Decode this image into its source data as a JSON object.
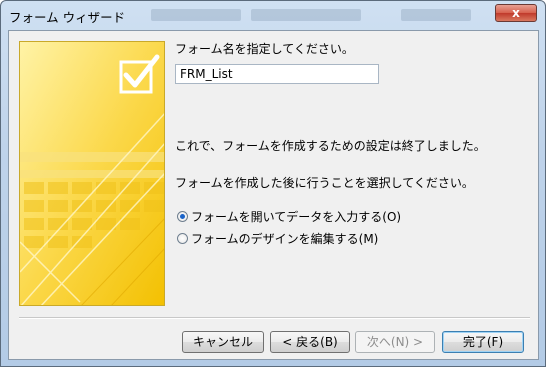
{
  "window": {
    "title": "フォーム ウィザード",
    "close_label": "x"
  },
  "main": {
    "prompt": "フォーム名を指定してください。",
    "form_name": "FRM_List",
    "done_message": "これで、フォームを作成するための設定は終了しました。",
    "question": "フォームを作成した後に行うことを選択してください。",
    "options": [
      {
        "label": "フォームを開いてデータを入力する(O)",
        "selected": true
      },
      {
        "label": "フォームのデザインを編集する(M)",
        "selected": false
      }
    ]
  },
  "buttons": {
    "cancel": "キャンセル",
    "back": "< 戻る(B)",
    "next": "次へ(N) >",
    "finish": "完了(F)"
  },
  "colors": {
    "accent": "#f2c21b",
    "image_light": "#fbe27a",
    "image_dark": "#e9b500"
  }
}
